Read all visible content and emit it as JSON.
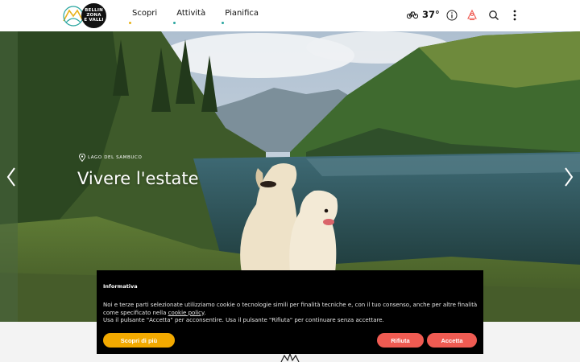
{
  "header": {
    "logo_text": [
      "BELLIN",
      "ZONA",
      "E VALLI"
    ],
    "nav": [
      {
        "label": "Scopri"
      },
      {
        "label": "Attività"
      },
      {
        "label": "Pianifica"
      }
    ],
    "weather": {
      "temperature": "37°",
      "icon": "bicycle-weather-icon"
    },
    "icons": [
      "info-icon",
      "alert-icon",
      "search-icon",
      "more-vertical-icon"
    ]
  },
  "hero": {
    "location": "LAGO DEL SAMBUCO",
    "title": "Vivere l'estate",
    "prev_icon": "chevron-left-icon",
    "next_icon": "chevron-right-icon"
  },
  "cookie_banner": {
    "title": "Informativa",
    "text_1": "Noi e terze parti selezionate utilizziamo cookie o tecnologie simili per finalità tecniche e, con il tuo consenso, anche per altre finalità come specificato nella ",
    "link": "cookie policy",
    "text_2": ".",
    "text_3": "Usa il pulsante \"Accetta\" per acconsentire. Usa il pulsante \"Rifiuta\" per continuare senza accettare.",
    "learn_more": "Scopri di più",
    "reject": "Rifiuta",
    "accept": "Accetta"
  },
  "colors": {
    "accent_yellow": "#f2a900",
    "accent_red": "#ef5b52",
    "accent_teal": "#2aa6a0"
  }
}
